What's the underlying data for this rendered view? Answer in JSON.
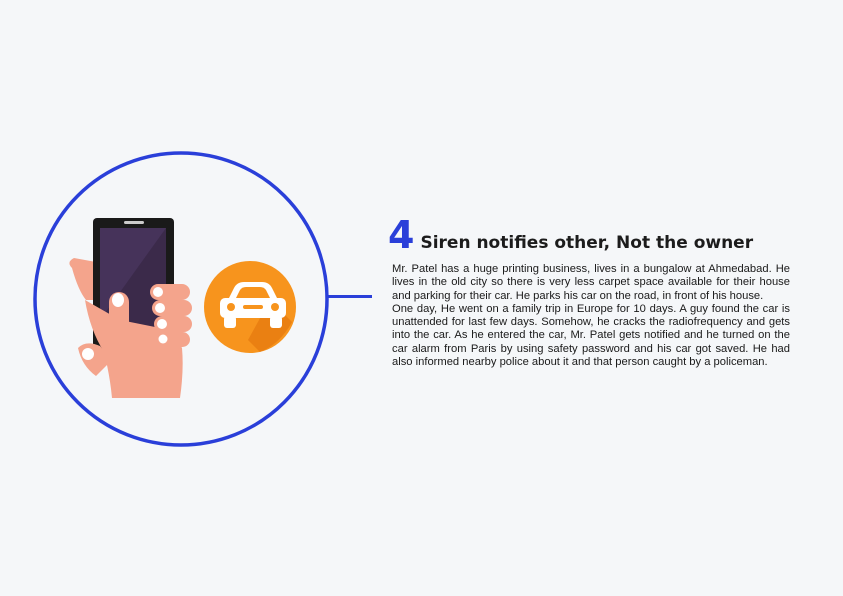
{
  "step": {
    "number": "4",
    "title": "Siren notifies other, Not the owner"
  },
  "story": {
    "paragraphs": [
      "Mr. Patel has a huge printing business, lives in a bungalow at Ahmedabad. He lives in the old city so there is very less carpet space available for their house and parking for their car. He parks his car on the road, in front of his house.",
      "One day, He went on a family trip in Europe for 10 days. A guy found the car is unattended for last few days. Somehow, he cracks the radiofrequency and gets into the car. As he entered the car, Mr. Patel gets notified and he turned on the car alarm from Paris by using safety password and his car got saved. He had also informed nearby police about it and that person caught by a policeman."
    ]
  },
  "colors": {
    "accent": "#2a3fd9",
    "background": "#f5f7f9",
    "badge": "#f7941d",
    "badge_shadow": "#e0700a",
    "skin": "#f4a48c",
    "phone": "#1a1a1a",
    "screen": "#3b2a4a"
  },
  "icons": {
    "hand_phone": "hand-holding-phone-icon",
    "car": "car-icon"
  }
}
